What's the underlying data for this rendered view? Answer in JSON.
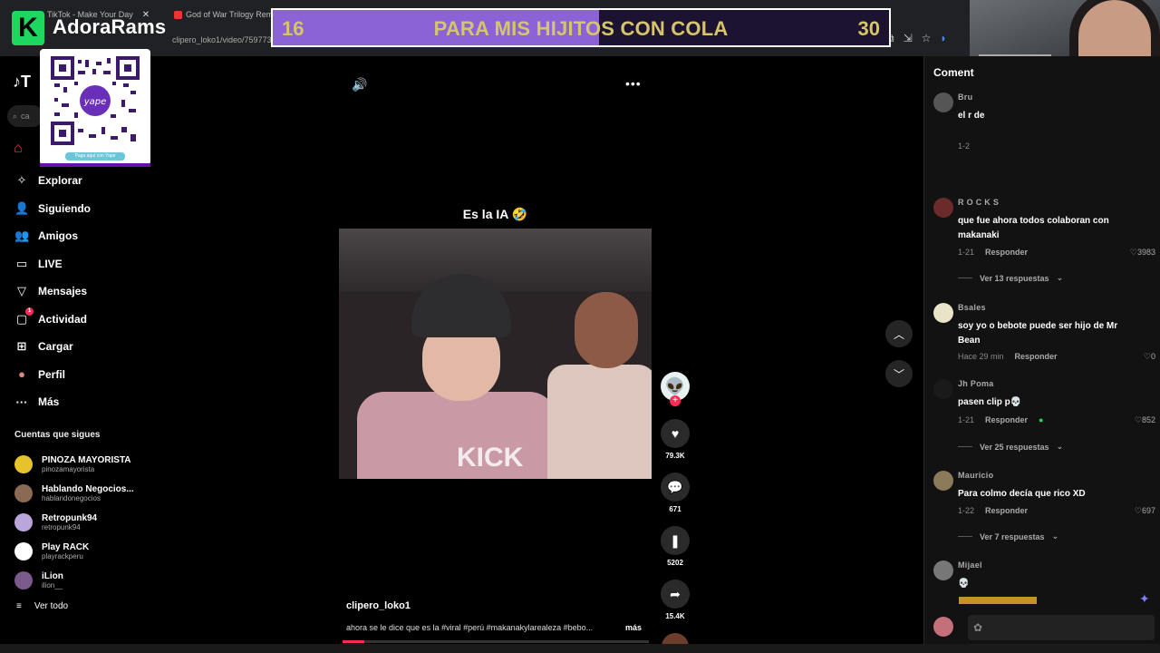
{
  "browser": {
    "tabs": [
      {
        "label": "TikTok - Make Your Day",
        "close": "✕"
      },
      {
        "label": "God of War Trilogy Remak"
      }
    ],
    "url": "clipero_loko1/video/759773"
  },
  "overlay": {
    "logo_letter": "K",
    "streamer_name": "AdoraRams",
    "qr_caption": "Paga aquí con Yape",
    "qr_brand": "yape"
  },
  "goal": {
    "current": "16",
    "title": "PARA MIS HIJITOS CON COLA",
    "target": "30",
    "progress": 0.53,
    "fill_color": "#8b63d6"
  },
  "sidebar": {
    "brand": "T",
    "search_placeholder": "ca",
    "nav": [
      {
        "icon": "compass-icon",
        "glyph": "✧",
        "label": "Explorar"
      },
      {
        "icon": "following-icon",
        "glyph": "👤",
        "label": "Siguiendo"
      },
      {
        "icon": "friends-icon",
        "glyph": "👥",
        "label": "Amigos"
      },
      {
        "icon": "live-icon",
        "glyph": "▭",
        "label": "LIVE"
      },
      {
        "icon": "messages-icon",
        "glyph": "▽",
        "label": "Mensajes"
      },
      {
        "icon": "activity-icon",
        "glyph": "▢",
        "label": "Actividad",
        "badge": "1"
      },
      {
        "icon": "upload-icon",
        "glyph": "⊞",
        "label": "Cargar"
      },
      {
        "icon": "profile-icon",
        "glyph": "●",
        "label": "Perfil"
      },
      {
        "icon": "more-icon",
        "glyph": "···",
        "label": "Más"
      }
    ],
    "following_title": "Cuentas que sigues",
    "following": [
      {
        "name": "PINOZA MAYORISTA",
        "handle": "pinozamayorista",
        "color": "#e6c32a"
      },
      {
        "name": "Hablando Negocios...",
        "handle": "hablandonegocios",
        "color": "#8a6a55"
      },
      {
        "name": "Retropunk94",
        "handle": "retropunk94",
        "color": "#b9a5d8"
      },
      {
        "name": "Play RACK",
        "handle": "playrackperu",
        "color": "#ffffff"
      },
      {
        "name": "iLion",
        "handle": "ilion__",
        "color": "#7a5a8a"
      }
    ],
    "see_all": "Ver todo"
  },
  "video": {
    "caption_top": "Es la IA 🤣",
    "watermark": "KICK",
    "author": "clipero_loko1",
    "description": "ahora se le dice que es la #viral #perú #makanakylarealeza #bebo...",
    "more_label": "más",
    "progress": 0.07
  },
  "actions": {
    "likes": "79.3K",
    "comments": "671",
    "saves": "5202",
    "shares": "15.4K"
  },
  "comments": {
    "title": "Coment",
    "items": [
      {
        "user": "Bru",
        "text": "el r de",
        "date": "1-2",
        "avatar": "#555"
      },
      {
        "user": "R O C K S",
        "text": "que fue ahora todos colaboran con makanaki",
        "date": "1-21",
        "reply": "Responder",
        "likes": "3983",
        "replies": "Ver 13 respuestas",
        "avatar": "#6b2b2b"
      },
      {
        "user": "Bsales",
        "text": "soy yo o bebote puede ser hijo de Mr Bean",
        "date": "Hace 29 min",
        "reply": "Responder",
        "likes": "0",
        "avatar": "#e9e4c8"
      },
      {
        "user": "Jh Poma",
        "text": "pasen clip p💀",
        "date": "1-21",
        "reply": "Responder",
        "likes": "852",
        "replies": "Ver 25 respuestas",
        "avatar": "#1a1a1a"
      },
      {
        "user": "Mauricio",
        "text": "Para colmo decía que rico XD",
        "date": "1-22",
        "reply": "Responder",
        "likes": "697",
        "replies": "Ver 7 respuestas",
        "avatar": "#8a7a5a"
      },
      {
        "user": "Mijael",
        "text": "💀",
        "avatar": "#777"
      }
    ]
  }
}
